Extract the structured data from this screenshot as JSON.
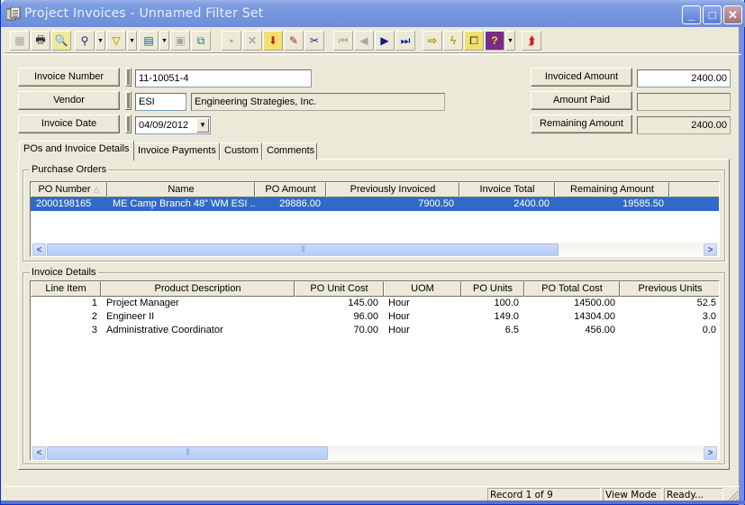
{
  "window": {
    "title": "Project Invoices - Unnamed Filter Set",
    "controls": {
      "minimize": "_",
      "maximize": "□",
      "close": "✕"
    }
  },
  "toolbar": {
    "buttons": [
      {
        "name": "new-record",
        "icon": "▦",
        "enabled": false
      },
      {
        "name": "print",
        "icon": "🖶",
        "enabled": true
      },
      {
        "name": "print-preview",
        "icon": "🔍",
        "enabled": true
      },
      {
        "name": "find",
        "icon": "⚲",
        "enabled": true
      },
      {
        "name": "filter",
        "icon": "▽",
        "enabled": true
      },
      {
        "name": "report",
        "icon": "▤",
        "enabled": true
      },
      {
        "name": "properties",
        "icon": "▣",
        "enabled": false
      },
      {
        "name": "export",
        "icon": "⧉",
        "enabled": true
      },
      {
        "name": "save",
        "icon": "▪",
        "enabled": false
      },
      {
        "name": "delete",
        "icon": "✕",
        "enabled": false
      },
      {
        "name": "add-layer",
        "icon": "⬇",
        "enabled": true
      },
      {
        "name": "edit",
        "icon": "✎",
        "enabled": true
      },
      {
        "name": "cut",
        "icon": "✂",
        "enabled": true
      },
      {
        "name": "first-record",
        "icon": "⏮",
        "enabled": false
      },
      {
        "name": "previous-record",
        "icon": "◀",
        "enabled": false
      },
      {
        "name": "next-record",
        "icon": "▶",
        "enabled": true
      },
      {
        "name": "last-record",
        "icon": "⏭",
        "enabled": true
      },
      {
        "name": "go-to",
        "icon": "⇨",
        "enabled": true
      },
      {
        "name": "quick-action",
        "icon": "ϟ",
        "enabled": true
      },
      {
        "name": "workflow",
        "icon": "⧠",
        "enabled": true
      },
      {
        "name": "help-book",
        "icon": "?",
        "enabled": true
      },
      {
        "name": "send",
        "icon": "⮭",
        "enabled": true
      }
    ]
  },
  "header": {
    "invoice_number": {
      "label": "Invoice Number",
      "value": "11-10051-4"
    },
    "vendor": {
      "label": "Vendor",
      "code": "ESI",
      "name": "Engineering Strategies, Inc."
    },
    "invoice_date": {
      "label": "Invoice Date",
      "value": "04/09/2012"
    },
    "invoiced_amount": {
      "label": "Invoiced Amount",
      "value": "2400.00"
    },
    "amount_paid": {
      "label": "Amount Paid",
      "value": ""
    },
    "remaining_amount": {
      "label": "Remaining Amount",
      "value": "2400.00"
    }
  },
  "tabs": [
    {
      "label": "POs and Invoice Details",
      "active": true
    },
    {
      "label": "Invoice Payments",
      "active": false
    },
    {
      "label": "Custom",
      "active": false
    },
    {
      "label": "Comments",
      "active": false
    }
  ],
  "purchase_orders": {
    "title": "Purchase Orders",
    "columns": [
      "PO Number",
      "Name",
      "PO Amount",
      "Previously Invoiced",
      "Invoice Total",
      "Remaining Amount",
      ""
    ],
    "sort_indicator": "△",
    "rows": [
      {
        "po_number": "2000198165",
        "name": "ME Camp Branch 48\" WM ESI ...",
        "po_amount": "29886.00",
        "previously_invoiced": "7900.50",
        "invoice_total": "2400.00",
        "remaining_amount": "19585.50",
        "selected": true
      }
    ]
  },
  "invoice_details": {
    "title": "Invoice Details",
    "columns": [
      "Line Item",
      "Product Description",
      "PO Unit Cost",
      "UOM",
      "PO Units",
      "PO Total Cost",
      "Previous Units"
    ],
    "rows": [
      {
        "line_item": "1",
        "description": "Project Manager",
        "unit_cost": "145.00",
        "uom": "Hour",
        "po_units": "100.0",
        "total_cost": "14500.00",
        "previous_units": "52.5"
      },
      {
        "line_item": "2",
        "description": "Engineer II",
        "unit_cost": "96.00",
        "uom": "Hour",
        "po_units": "149.0",
        "total_cost": "14304.00",
        "previous_units": "3.0"
      },
      {
        "line_item": "3",
        "description": "Administrative Coordinator",
        "unit_cost": "70.00",
        "uom": "Hour",
        "po_units": "6.5",
        "total_cost": "456.00",
        "previous_units": "0.0"
      }
    ]
  },
  "scroll": {
    "left_arrow": "<",
    "right_arrow": ">",
    "grip": "||||"
  },
  "status": {
    "record": "Record 1 of 9",
    "mode": "View Mode",
    "state": "Ready..."
  }
}
